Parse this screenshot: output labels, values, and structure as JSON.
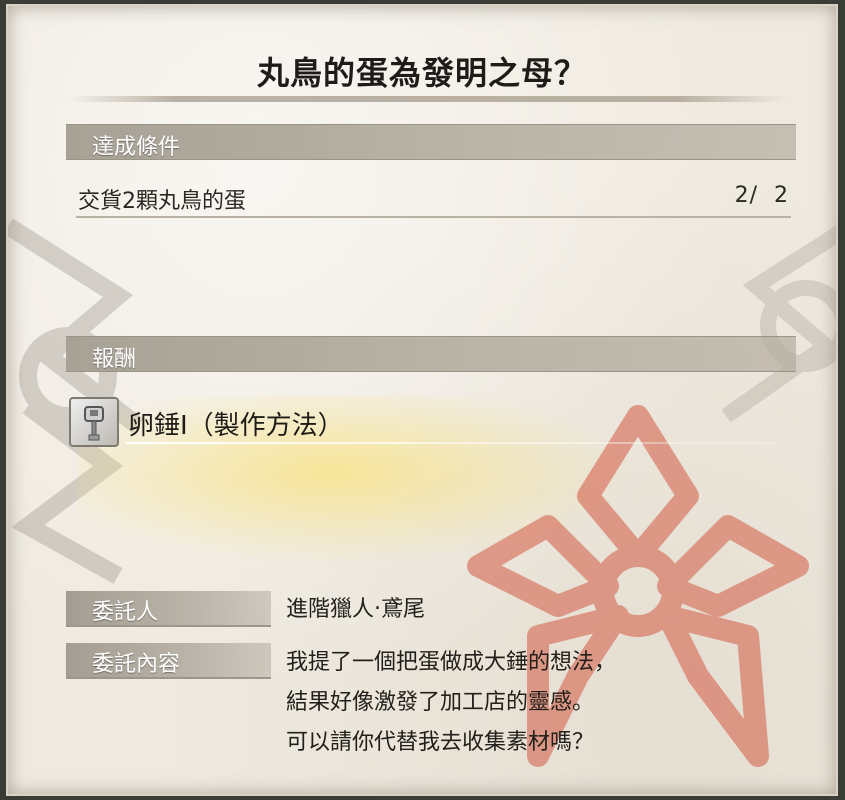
{
  "quest": {
    "title": "丸鳥的蛋為發明之母？"
  },
  "conditions": {
    "header": "達成條件",
    "items": [
      {
        "text": "交貨2顆丸鳥的蛋",
        "progress": "2/  2"
      }
    ]
  },
  "rewards": {
    "header": "報酬",
    "items": [
      {
        "icon": "hammer-icon",
        "label": "卵錘Ⅰ（製作方法）"
      }
    ]
  },
  "client": {
    "label": "委託人",
    "name": "進階獵人‧鳶尾"
  },
  "details": {
    "label": "委託內容",
    "lines": [
      "我提了一個把蛋做成大錘的想法，",
      "結果好像激發了加工店的靈感。",
      "可以請你代替我去收集素材嗎？"
    ]
  },
  "colors": {
    "paper": "#efeae0",
    "section_bar": "#b0aa9f",
    "emblem_red": "#d45a43",
    "glow_yellow": "#fae16e"
  }
}
